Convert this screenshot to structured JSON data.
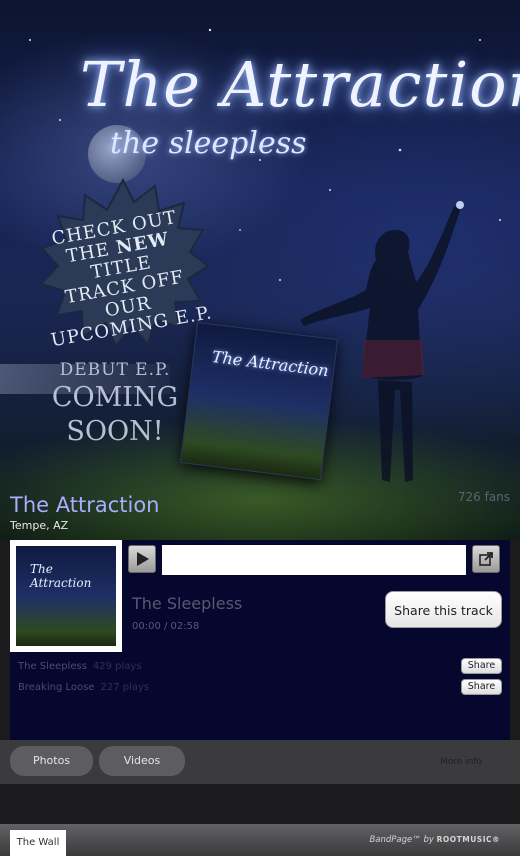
{
  "hero": {
    "logo_title": "The Attraction",
    "logo_subtitle": "the sleepless",
    "badge_lines": [
      "CHECK OUT",
      "THE",
      "NEW",
      "TITLE",
      "TRACK OFF OUR",
      "UPCOMING E.P."
    ],
    "debut_line1": "DEBUT E.P.",
    "debut_line2": "COMING",
    "debut_line3": "SOON!",
    "album_art_text": "The Attraction",
    "fans": "726 fans"
  },
  "band": {
    "name": "The Attraction",
    "location": "Tempe, AZ"
  },
  "player": {
    "cover_text": "The Attraction",
    "current_track": "The Sleepless",
    "time": "00:00 / 02:58",
    "share_track_label": "Share this track",
    "progress": 0,
    "tracks": [
      {
        "name": "The Sleepless",
        "plays": "429 plays",
        "share": "Share"
      },
      {
        "name": "Breaking Loose",
        "plays": "227 plays",
        "share": "Share"
      }
    ]
  },
  "tabs": {
    "photos": "Photos",
    "videos": "Videos",
    "more_info": "More info"
  },
  "footer": {
    "wall_tab": "The Wall",
    "powered_prefix": "BandPage™ by ",
    "powered_brand": "ROOTMUSIC®"
  },
  "colors": {
    "band_name": "#a8adff",
    "player_bg": "#06072e"
  }
}
